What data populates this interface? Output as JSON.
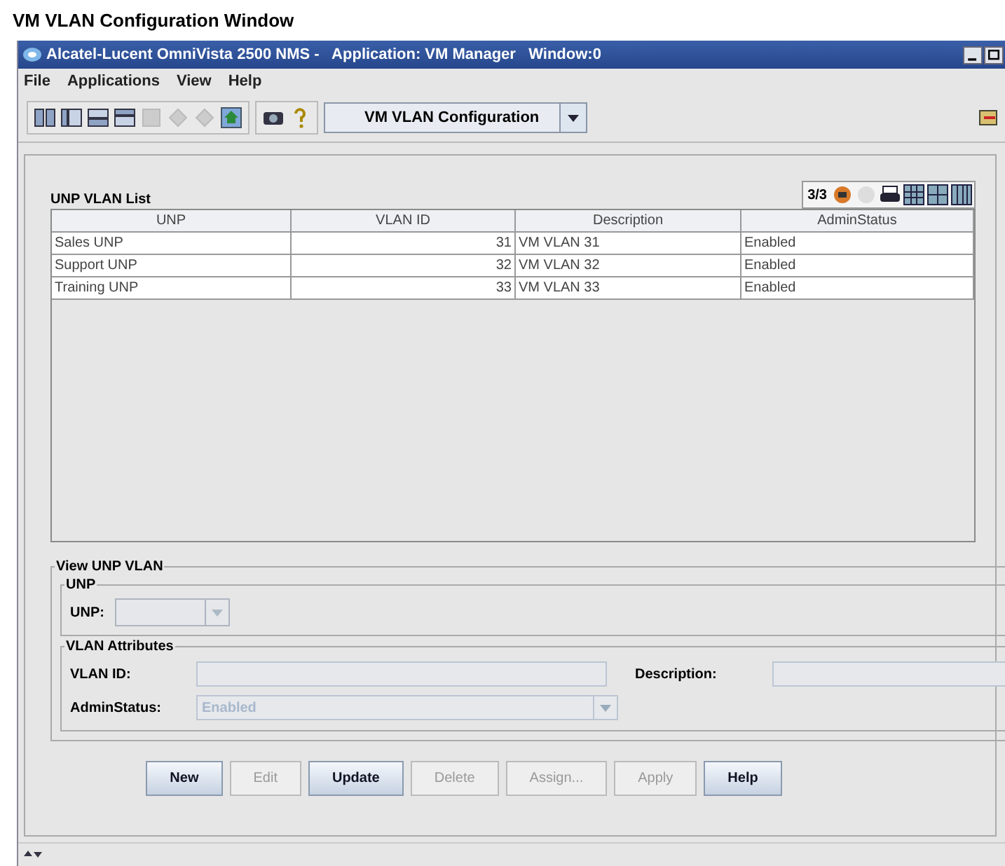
{
  "heading": "VM VLAN Configuration Window",
  "window": {
    "title": "Alcatel-Lucent OmniVista 2500 NMS -   Application: VM Manager   Window:0"
  },
  "menu": [
    "File",
    "Applications",
    "View",
    "Help"
  ],
  "toolbar": {
    "view_selector": "VM VLAN Configuration"
  },
  "list": {
    "title": "UNP VLAN List",
    "count": "3/3",
    "columns": [
      "UNP",
      "VLAN ID",
      "Description",
      "AdminStatus"
    ],
    "rows": [
      {
        "unp": "Sales UNP",
        "vlan_id": "31",
        "description": "VM VLAN 31",
        "admin_status": "Enabled"
      },
      {
        "unp": "Support UNP",
        "vlan_id": "32",
        "description": "VM VLAN 32",
        "admin_status": "Enabled"
      },
      {
        "unp": "Training UNP",
        "vlan_id": "33",
        "description": "VM VLAN 33",
        "admin_status": "Enabled"
      }
    ]
  },
  "form": {
    "title": "View UNP VLAN",
    "unp_group": {
      "title": "UNP",
      "label": "UNP:",
      "disabled": true
    },
    "attributes": {
      "title": "VLAN Attributes",
      "vlan_id_label": "VLAN ID:",
      "description_label": "Description:",
      "admin_status_label": "AdminStatus:",
      "admin_status_value": "Enabled",
      "disabled": true
    }
  },
  "buttons": [
    {
      "label": "New",
      "disabled": false
    },
    {
      "label": "Edit",
      "disabled": true
    },
    {
      "label": "Update",
      "disabled": false
    },
    {
      "label": "Delete",
      "disabled": true
    },
    {
      "label": "Assign...",
      "disabled": true
    },
    {
      "label": "Apply",
      "disabled": true
    },
    {
      "label": "Help",
      "disabled": false
    }
  ]
}
